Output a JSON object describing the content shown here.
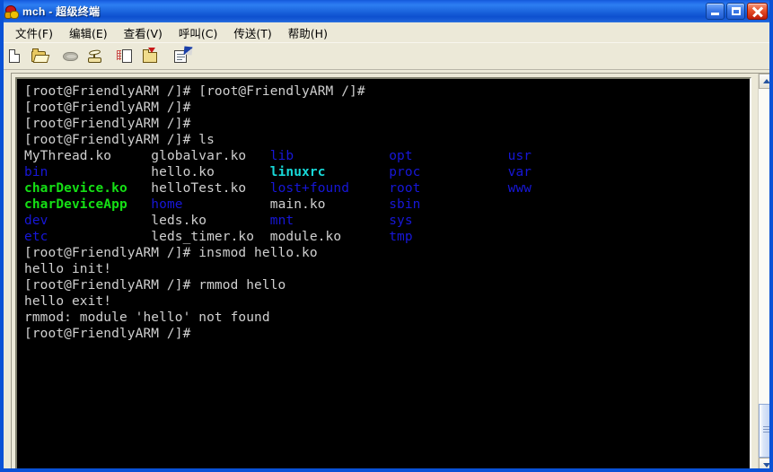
{
  "window": {
    "title": "mch - 超级终端",
    "app_icon": "hyperterminal-icon",
    "controls": {
      "minimize": "minimize",
      "maximize": "maximize",
      "close": "close"
    }
  },
  "menubar": {
    "items": [
      {
        "label": "文件(F)"
      },
      {
        "label": "编辑(E)"
      },
      {
        "label": "查看(V)"
      },
      {
        "label": "呼叫(C)"
      },
      {
        "label": "传送(T)"
      },
      {
        "label": "帮助(H)"
      }
    ]
  },
  "toolbar": {
    "buttons": [
      {
        "name": "new-connection",
        "icon": "new-document-icon"
      },
      {
        "name": "open-connection",
        "icon": "open-folder-icon"
      },
      {
        "name": "disconnect",
        "icon": "disconnect-phone-icon"
      },
      {
        "name": "call",
        "icon": "call-phone-icon"
      },
      {
        "name": "send-file",
        "icon": "send-document-icon"
      },
      {
        "name": "receive-file",
        "icon": "receive-folder-icon"
      },
      {
        "name": "properties",
        "icon": "properties-icon"
      }
    ]
  },
  "terminal": {
    "colors": {
      "background": "#000000",
      "foreground": "#d0d0d0",
      "blue": "#1717d8",
      "green": "#15e015",
      "cyan": "#18d8d8"
    },
    "lines": [
      {
        "segments": [
          {
            "text": "[root@FriendlyARM /]# [root@FriendlyARM /]#",
            "color": "white"
          }
        ]
      },
      {
        "segments": [
          {
            "text": "[root@FriendlyARM /]#",
            "color": "white"
          }
        ]
      },
      {
        "segments": [
          {
            "text": "[root@FriendlyARM /]#",
            "color": "white"
          }
        ]
      },
      {
        "segments": [
          {
            "text": "[root@FriendlyARM /]# ls",
            "color": "white"
          }
        ]
      },
      {
        "segments": [
          {
            "text": "MyThread.ko     ",
            "color": "white"
          },
          {
            "text": "globalvar.ko   ",
            "color": "white"
          },
          {
            "text": "lib            ",
            "color": "blue"
          },
          {
            "text": "opt            ",
            "color": "blue"
          },
          {
            "text": "usr",
            "color": "blue"
          }
        ]
      },
      {
        "segments": [
          {
            "text": "bin             ",
            "color": "blue"
          },
          {
            "text": "hello.ko       ",
            "color": "white"
          },
          {
            "text": "linuxrc        ",
            "color": "cyan"
          },
          {
            "text": "proc           ",
            "color": "blue"
          },
          {
            "text": "var",
            "color": "blue"
          }
        ]
      },
      {
        "segments": [
          {
            "text": "charDevice.ko   ",
            "color": "green"
          },
          {
            "text": "helloTest.ko   ",
            "color": "white"
          },
          {
            "text": "lost+found     ",
            "color": "blue"
          },
          {
            "text": "root           ",
            "color": "blue"
          },
          {
            "text": "www",
            "color": "blue"
          }
        ]
      },
      {
        "segments": [
          {
            "text": "charDeviceApp   ",
            "color": "green"
          },
          {
            "text": "home           ",
            "color": "blue"
          },
          {
            "text": "main.ko        ",
            "color": "white"
          },
          {
            "text": "sbin",
            "color": "blue"
          }
        ]
      },
      {
        "segments": [
          {
            "text": "dev             ",
            "color": "blue"
          },
          {
            "text": "leds.ko        ",
            "color": "white"
          },
          {
            "text": "mnt            ",
            "color": "blue"
          },
          {
            "text": "sys",
            "color": "blue"
          }
        ]
      },
      {
        "segments": [
          {
            "text": "etc             ",
            "color": "blue"
          },
          {
            "text": "leds_timer.ko  ",
            "color": "white"
          },
          {
            "text": "module.ko      ",
            "color": "white"
          },
          {
            "text": "tmp",
            "color": "blue"
          }
        ]
      },
      {
        "segments": [
          {
            "text": "[root@FriendlyARM /]# insmod hello.ko",
            "color": "white"
          }
        ]
      },
      {
        "segments": [
          {
            "text": "hello init!",
            "color": "white"
          }
        ]
      },
      {
        "segments": [
          {
            "text": "[root@FriendlyARM /]# rmmod hello",
            "color": "white"
          }
        ]
      },
      {
        "segments": [
          {
            "text": "hello exit!",
            "color": "white"
          }
        ]
      },
      {
        "segments": [
          {
            "text": "rmmod: module 'hello' not found",
            "color": "white"
          }
        ]
      },
      {
        "segments": [
          {
            "text": "[root@FriendlyARM /]#",
            "color": "white"
          }
        ]
      }
    ]
  },
  "scrollbar": {
    "up_arrow": "scroll-up",
    "down_arrow": "scroll-down",
    "thumb": "scroll-thumb"
  }
}
